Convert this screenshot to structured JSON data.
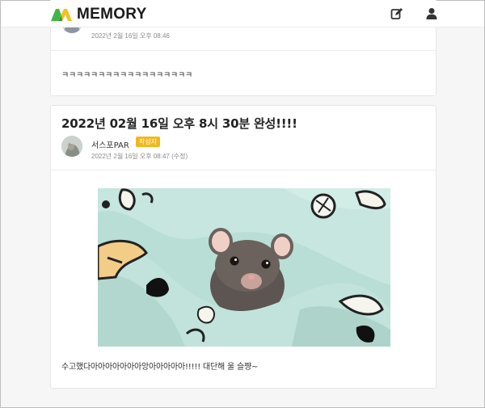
{
  "header": {
    "logo_text": "MEMORY",
    "write_icon": "edit-icon",
    "user_icon": "user-icon"
  },
  "comment": {
    "date": "2022년 2월 16일 오후 08:46",
    "text": "ㅋㅋㅋㅋㅋㅋㅋㅋㅋㅋㅋㅋㅋㅋㅋㅋㅋㅋ"
  },
  "post": {
    "title": "2022년 02월 16일 오후 8시 30분 완성!!!!",
    "author": "서스포PAR",
    "badge": "작성자",
    "date": "2022년 2월 16일 오후 08:47 (수정)",
    "body": "수고했다아아아아아아아앙아아아아아!!!!! 대단해 울 슬쨩~"
  },
  "colors": {
    "badge": "#f1b81e",
    "logo_green": "#3fb54a",
    "logo_yellow": "#f3c221"
  }
}
